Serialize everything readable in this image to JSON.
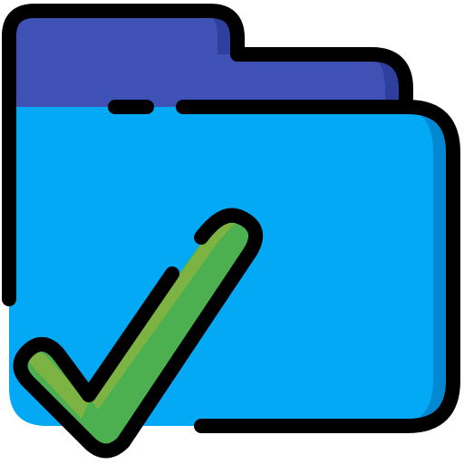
{
  "icon": {
    "name": "folder-check-icon",
    "colors": {
      "folder_back": "#3F51B5",
      "folder_back_shade": "#2F3F9E",
      "folder_front": "#03A9F4",
      "folder_front_shade": "#0288D1",
      "check_fill": "#4CAF50",
      "check_highlight": "#7CB342",
      "outline": "#000000",
      "background": "#FFFFFF"
    }
  }
}
